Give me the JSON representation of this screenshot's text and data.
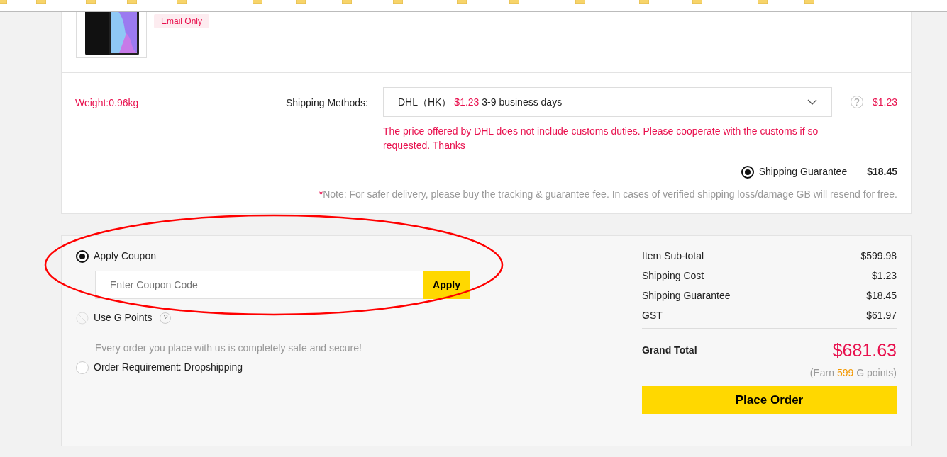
{
  "product": {
    "badge": "Email Only"
  },
  "shipping": {
    "weight": "Weight:0.96kg",
    "methods_label": "Shipping Methods:",
    "method": {
      "carrier": "DHL（HK）",
      "price": "$1.23",
      "time": "3-9 business days"
    },
    "price": "$1.23",
    "help": "?",
    "warning": "The price offered by DHL does not include customs duties. Please cooperate with the customs if so requested. Thanks",
    "guarantee": {
      "label": "Shipping Guarantee",
      "checked": true,
      "price": "$18.45"
    },
    "note": {
      "mark": "*",
      "text": "Note: For safer delivery, please buy the tracking & guarantee fee. In cases of verified shipping loss/damage GB will resend for free."
    }
  },
  "options": [
    {
      "label": "Apply Coupon",
      "selected": true,
      "disabled": false,
      "coupon": {
        "placeholder": "Enter Coupon Code",
        "button": "Apply"
      }
    },
    {
      "label": "Use G Points",
      "selected": false,
      "disabled": true,
      "help": "?",
      "note": "Every order you place with us is completely safe and secure!"
    },
    {
      "label": "Order Requirement: Dropshipping",
      "selected": false,
      "disabled": false
    }
  ],
  "summary": {
    "rows": [
      {
        "label": "Item Sub-total",
        "value": "$599.98"
      },
      {
        "label": "Shipping Cost",
        "value": "$1.23"
      },
      {
        "label": "Shipping Guarantee",
        "value": "$18.45"
      },
      {
        "label": "GST",
        "value": "$61.97"
      }
    ],
    "grand_total": {
      "label": "Grand Total",
      "value": "$681.63"
    },
    "earn": {
      "prefix": "(Earn ",
      "points": "599",
      "suffix": " G points)"
    },
    "button": "Place Order"
  },
  "annotation": {
    "kind": "ellipse",
    "color": "#ff0000"
  }
}
